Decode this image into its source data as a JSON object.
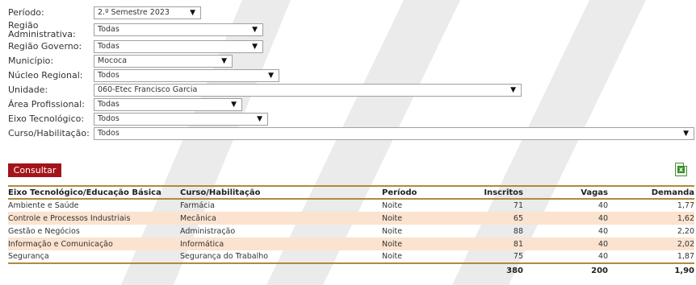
{
  "filters": [
    {
      "label": "Período:",
      "value": "2.º Semestre 2023",
      "key": "periodo"
    },
    {
      "label": "Região Administrativa:",
      "value": "Todas",
      "key": "regiao-administrativa"
    },
    {
      "label": "Região Governo:",
      "value": "Todas",
      "key": "regiao-governo"
    },
    {
      "label": "Município:",
      "value": "Mococa",
      "key": "municipio"
    },
    {
      "label": "Núcleo Regional:",
      "value": "Todos",
      "key": "nucleo-regional"
    },
    {
      "label": "Unidade:",
      "value": "060-Etec Francisco Garcia",
      "key": "unidade"
    },
    {
      "label": "Área Profissional:",
      "value": "Todas",
      "key": "area-profissional"
    },
    {
      "label": "Eixo Tecnológico:",
      "value": "Todos",
      "key": "eixo-tecnologico"
    },
    {
      "label": "Curso/Habilitação:",
      "value": "Todos",
      "key": "curso-habilitacao"
    }
  ],
  "consult_label": "Consultar",
  "export_icon": "excel-export-icon",
  "table": {
    "headers": [
      "Eixo Tecnológico/Educação Básica",
      "Curso/Habilitação",
      "Período",
      "Inscritos",
      "Vagas",
      "Demanda"
    ],
    "rows": [
      [
        "Ambiente e Saúde",
        "Farmácia",
        "Noite",
        "71",
        "40",
        "1,77"
      ],
      [
        "Controle e Processos Industriais",
        "Mecânica",
        "Noite",
        "65",
        "40",
        "1,62"
      ],
      [
        "Gestão e Negócios",
        "Administração",
        "Noite",
        "88",
        "40",
        "2,20"
      ],
      [
        "Informação e Comunicação",
        "Informática",
        "Noite",
        "81",
        "40",
        "2,02"
      ],
      [
        "Segurança",
        "Segurança do Trabalho",
        "Noite",
        "75",
        "40",
        "1,87"
      ]
    ],
    "totals": [
      "",
      "",
      "",
      "380",
      "200",
      "1,90"
    ]
  },
  "colors": {
    "button": "#a3131a",
    "row_alt": "#fbe3cf",
    "rule": "#b08a3e"
  }
}
